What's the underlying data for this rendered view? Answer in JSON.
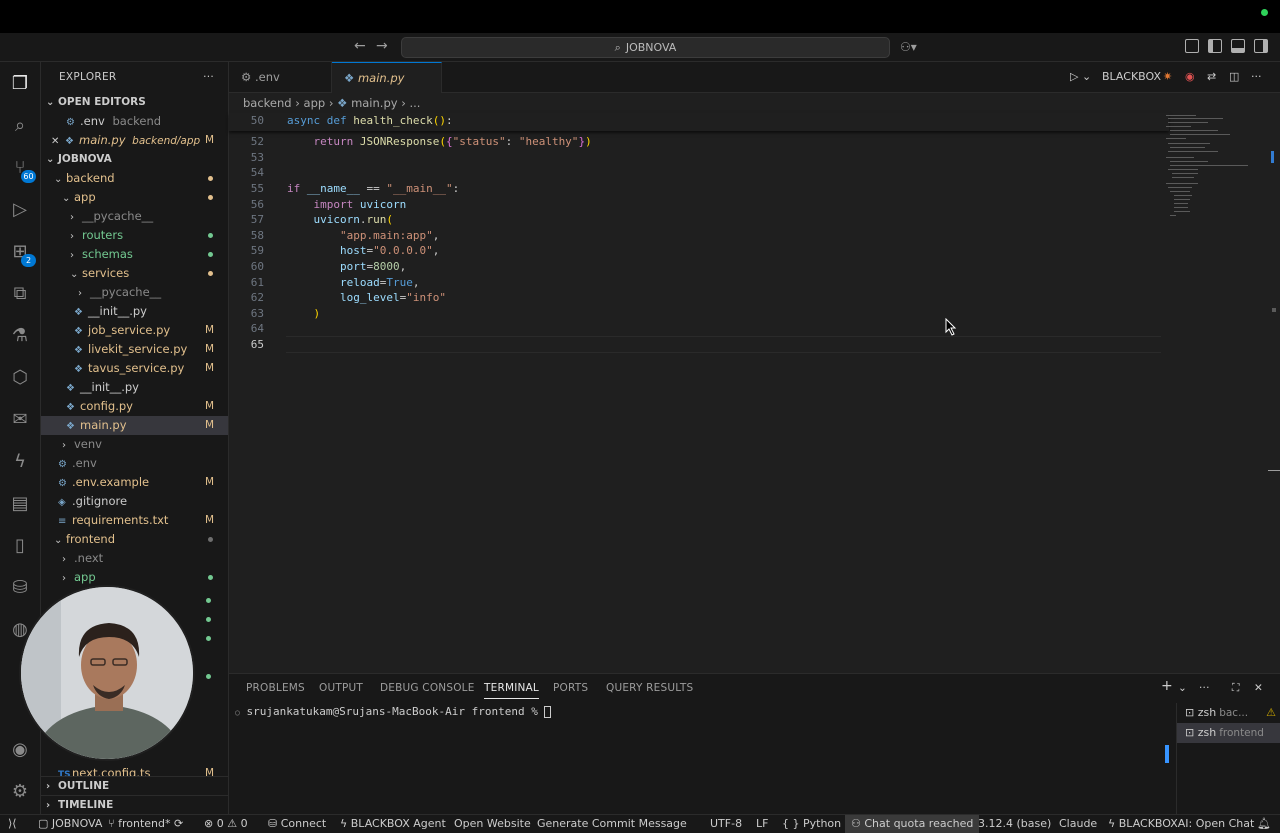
{
  "window": {
    "search_title": "JOBNOVA"
  },
  "explorer": {
    "header": "EXPLORER",
    "open_editors_label": "OPEN EDITORS",
    "open_editors": [
      {
        "name": ".env",
        "path": "backend"
      },
      {
        "name": "main.py",
        "path": "backend/app",
        "mark": "M"
      }
    ],
    "project_label": "JOBNOVA",
    "tree": [
      {
        "name": "backend"
      },
      {
        "name": "app"
      },
      {
        "name": "__pycache__"
      },
      {
        "name": "routers"
      },
      {
        "name": "schemas"
      },
      {
        "name": "services"
      },
      {
        "name": "__pycache__"
      },
      {
        "name": "__init__.py"
      },
      {
        "name": "job_service.py",
        "mark": "M"
      },
      {
        "name": "livekit_service.py",
        "mark": "M"
      },
      {
        "name": "tavus_service.py",
        "mark": "M"
      },
      {
        "name": "__init__.py"
      },
      {
        "name": "config.py",
        "mark": "M"
      },
      {
        "name": "main.py",
        "mark": "M"
      },
      {
        "name": "venv"
      },
      {
        "name": ".env"
      },
      {
        "name": ".env.example",
        "mark": "M"
      },
      {
        "name": ".gitignore"
      },
      {
        "name": "requirements.txt",
        "mark": "M"
      },
      {
        "name": "frontend"
      },
      {
        "name": ".next"
      },
      {
        "name": "app"
      },
      {
        "name": "next.config.ts",
        "mark": "M"
      }
    ],
    "outline_label": "OUTLINE",
    "timeline_label": "TIMELINE"
  },
  "activity_badges": {
    "source_control": "60",
    "extensions": "2"
  },
  "tabs": [
    {
      "label": ".env"
    },
    {
      "label": "main.py",
      "mark": "M"
    }
  ],
  "editor_actions": {
    "blackbox": "BLACKBOX"
  },
  "breadcrumb": [
    "backend",
    "app",
    "main.py",
    "..."
  ],
  "code": {
    "sticky": {
      "num": "50",
      "text": "async def health_check():"
    },
    "lines": [
      {
        "num": "52",
        "text": "    return JSONResponse({\"status\": \"healthy\"})"
      },
      {
        "num": "53",
        "text": ""
      },
      {
        "num": "54",
        "text": ""
      },
      {
        "num": "55",
        "text": "if __name__ == \"__main__\":"
      },
      {
        "num": "56",
        "text": "    import uvicorn"
      },
      {
        "num": "57",
        "text": "    uvicorn.run("
      },
      {
        "num": "58",
        "text": "        \"app.main:app\","
      },
      {
        "num": "59",
        "text": "        host=\"0.0.0.0\","
      },
      {
        "num": "60",
        "text": "        port=8000,"
      },
      {
        "num": "61",
        "text": "        reload=True,"
      },
      {
        "num": "62",
        "text": "        log_level=\"info\""
      },
      {
        "num": "63",
        "text": "    )"
      },
      {
        "num": "64",
        "text": ""
      },
      {
        "num": "65",
        "text": ""
      }
    ]
  },
  "panel": {
    "tabs": [
      "PROBLEMS",
      "OUTPUT",
      "DEBUG CONSOLE",
      "TERMINAL",
      "PORTS",
      "QUERY RESULTS"
    ],
    "active_tab": "TERMINAL",
    "prompt": "srujankatukam@Srujans-MacBook-Air frontend % ",
    "terminals": [
      {
        "name": "zsh",
        "sub": "bac..."
      },
      {
        "name": "zsh",
        "sub": "frontend"
      }
    ]
  },
  "status": {
    "project": "JOBNOVA",
    "branch": "frontend*",
    "errors": "0",
    "warnings": "0",
    "connect": "Connect",
    "blackbox_agent": "BLACKBOX Agent",
    "open_website": "Open Website",
    "commit_msg": "Generate Commit Message",
    "encoding": "UTF-8",
    "eol": "LF",
    "language": "Python",
    "chat_quota": "Chat quota reached",
    "python_version": "3.12.4 (base)",
    "claude": "Claude",
    "blackboxai": "BLACKBOXAI: Open Chat"
  },
  "colors": {
    "accent": "#0078d4",
    "modified": "#e2c08d",
    "untracked": "#73c991"
  }
}
